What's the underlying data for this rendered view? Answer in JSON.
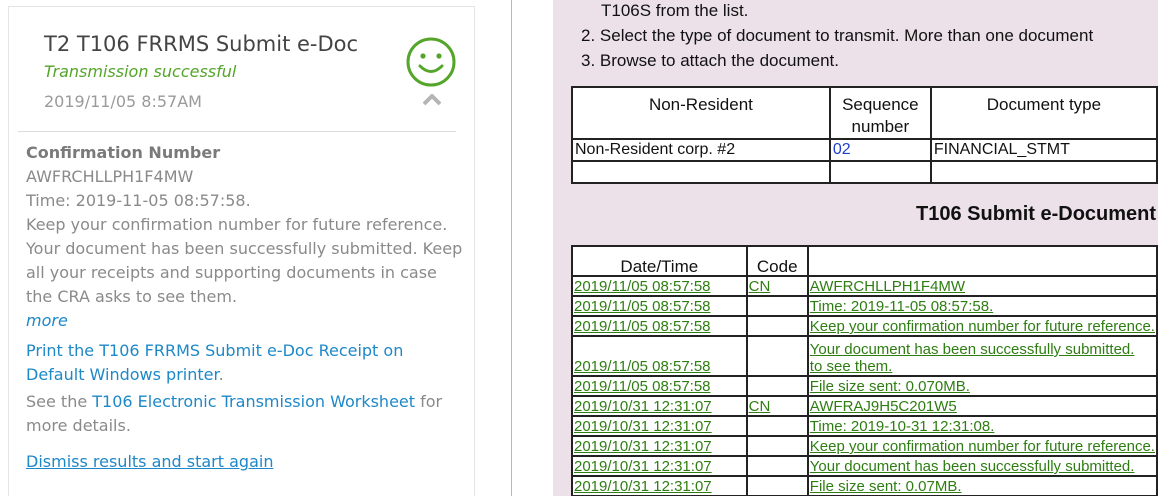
{
  "panel": {
    "title": "T2 T106 FRRMS Submit e-Doc",
    "status": "Transmission successful",
    "datetime": "2019/11/05 8:57AM",
    "status_icon": "smiley-icon",
    "collapse_icon": "chevron-up-icon",
    "colors": {
      "success": "#54a52a",
      "link": "#1e88c8",
      "muted": "#8a8a8a"
    },
    "confirmation_label": "Confirmation Number",
    "confirmation_number": "AWFRCHLLPH1F4MW",
    "time_line": "Time: 2019-11-05 08:57:58.",
    "keep_line": "Keep your confirmation number for future reference.",
    "submitted_line1": "Your document has been successfully submitted. Keep",
    "submitted_line2": "all your receipts and supporting documents in case",
    "submitted_line3": "the CRA asks to see them.",
    "more_link": "more",
    "print_link_line1": "Print the T106 FRRMS Submit e-Doc Receipt on",
    "print_link_line2": "Default Windows printer",
    "print_period": ".",
    "see_prefix": "See the ",
    "worksheet_link": "T106 Electronic Transmission Worksheet",
    "see_suffix": " for",
    "see_line2": "more details.",
    "dismiss_link": "Dismiss results and start again"
  },
  "doc": {
    "step_tail": "T106S from the list.",
    "step2": "2. Select the type of document to transmit. More than one document",
    "step3": "3. Browse to attach the document.",
    "table1": {
      "headers": [
        "Non-Resident",
        "Sequence",
        "number",
        "Document type"
      ],
      "rows": [
        {
          "name": "Non-Resident corp. #2",
          "seq": "02",
          "type": "FINANCIAL_STMT"
        },
        {
          "name": "",
          "seq": "",
          "type": ""
        }
      ]
    },
    "section_title": "T106 Submit e-Document",
    "table2": {
      "headers": [
        "Date/Time",
        "Code",
        ""
      ],
      "rows": [
        {
          "dt": "2019/11/05 08:57:58",
          "code": "CN",
          "msg": "AWFRCHLLPH1F4MW"
        },
        {
          "dt": "2019/11/05 08:57:58",
          "code": "",
          "msg": "Time: 2019-11-05 08:57:58."
        },
        {
          "dt": "2019/11/05 08:57:58",
          "code": "",
          "msg": "Keep your confirmation number for future reference."
        },
        {
          "dt": "2019/11/05 08:57:58",
          "code": "",
          "msg_line1": "Your document has been successfully submitted.",
          "msg_line2": "to see them."
        },
        {
          "dt": "2019/11/05 08:57:58",
          "code": "",
          "msg": "File size sent: 0.070MB."
        },
        {
          "dt": "2019/10/31 12:31:07",
          "code": "CN",
          "msg": "AWFRAJ9H5C201W5"
        },
        {
          "dt": "2019/10/31 12:31:07",
          "code": "",
          "msg": "Time: 2019-10-31 12:31:08."
        },
        {
          "dt": "2019/10/31 12:31:07",
          "code": "",
          "msg": "Keep your confirmation number for future reference."
        },
        {
          "dt": "2019/10/31 12:31:07",
          "code": "",
          "msg": "Your document has been successfully submitted."
        },
        {
          "dt": "2019/10/31 12:31:07",
          "code": "",
          "msg": "File size sent: 0.07MB."
        }
      ]
    }
  }
}
